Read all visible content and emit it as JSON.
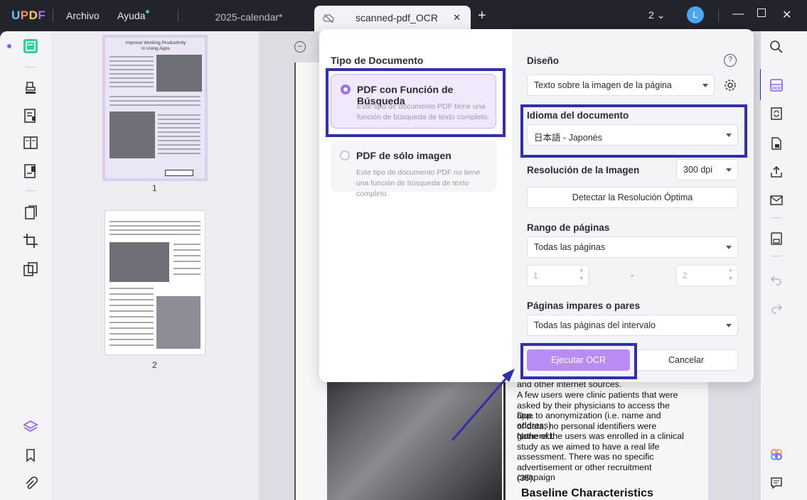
{
  "app": {
    "logo": "UPDF",
    "menu": {
      "file": "Archivo",
      "help": "Ayuda"
    },
    "tabs": [
      {
        "label": "2025-calendar*"
      },
      {
        "label": "scanned-pdf_OCR"
      }
    ],
    "page_count": "2",
    "avatar_initial": "L"
  },
  "thumbnails": {
    "page1": {
      "number": "1",
      "title_line1": "Improve Working Productivity",
      "title_line2": "in Using Apps"
    },
    "page2": {
      "number": "2"
    }
  },
  "document": {
    "text_lines": [
      "and other internet sources.",
      "A few users were clinic patients that were",
      "asked by their physicians to access the app.",
      "Due to anonymization (i.e. name and address)",
      "of data, no personal identifiers were gathered.",
      "None of the users was enrolled in a clinical",
      "study as we aimed to have a real life",
      "assessment. There was no specific",
      "advertisement or other    recruitment campaign",
      "(35)."
    ],
    "heading": "Baseline Characteristics"
  },
  "ocr_dialog": {
    "doc_type_title": "Tipo de Documento",
    "options": [
      {
        "label": "PDF con Función de Búsqueda",
        "description": "Este tipo de documento PDF tiene una función de búsqueda de texto completo.",
        "selected": true
      },
      {
        "label": "PDF de sólo imagen",
        "description": "Este tipo de documento PDF no tiene una función de búsqueda de texto completo.",
        "selected": false
      }
    ],
    "layout_label": "Diseño",
    "layout_value": "Texto sobre la imagen de la página",
    "help_symbol": "?",
    "language_label": "Idioma del documento",
    "language_value": "日本語 - Japonés",
    "resolution_label": "Resolución de la Imagen",
    "resolution_value": "300 dpi",
    "detect_button": "Detectar la Resolución Óptima",
    "range_label": "Rango de páginas",
    "range_value": "Todas las páginas",
    "range_from": "1",
    "range_dash": "-",
    "range_to": "2",
    "odd_even_label": "Páginas impares o pares",
    "odd_even_value": "Todas las páginas del intervalo",
    "run_button": "Ejecutar OCR",
    "cancel_button": "Cancelar"
  },
  "colors": {
    "accent": "#9b6ef0",
    "primary_button": "#b98bf4",
    "highlight_box": "#2f2fb0",
    "titlebar": "#23232b"
  }
}
